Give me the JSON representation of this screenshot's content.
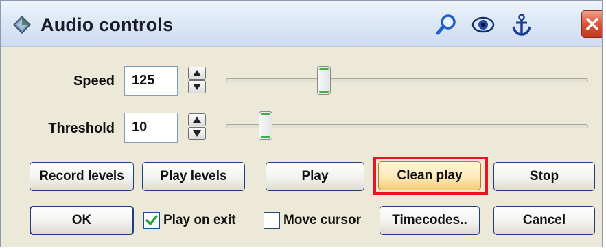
{
  "window": {
    "title": "Audio controls"
  },
  "titlebar_icons": [
    "diamond-icon",
    "search-icon",
    "eye-icon",
    "anchor-icon",
    "close-icon"
  ],
  "speed": {
    "label": "Speed",
    "value": "125",
    "slider_fraction": 0.27
  },
  "threshold": {
    "label": "Threshold",
    "value": "10",
    "slider_fraction": 0.11
  },
  "buttons": {
    "record_levels": "Record levels",
    "play_levels": "Play levels",
    "play": "Play",
    "clean_play": "Clean play",
    "stop": "Stop",
    "ok": "OK",
    "timecodes": "Timecodes..",
    "cancel": "Cancel"
  },
  "checkboxes": {
    "play_on_exit": {
      "label": "Play on exit",
      "checked": true
    },
    "move_cursor": {
      "label": "Move cursor",
      "checked": false
    }
  },
  "colors": {
    "highlight": "#e8141f",
    "button_border": "#1e3f7a",
    "focus_button": "#fde9b8",
    "thumb_accent": "#3fb046"
  }
}
